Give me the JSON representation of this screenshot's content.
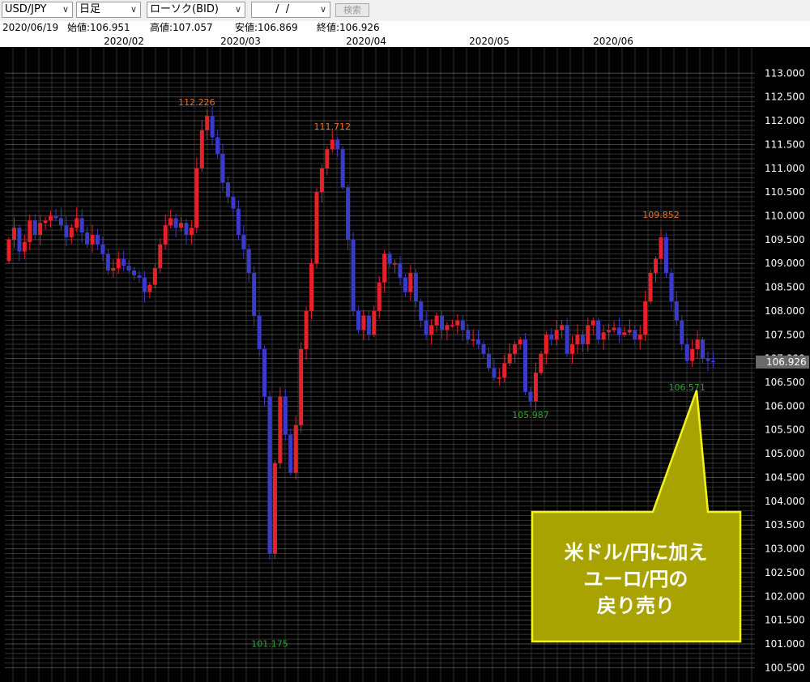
{
  "toolbar": {
    "symbol": "USD/JPY",
    "period": "日足",
    "chart_type": "ローソク(BID)",
    "date_value": " /  / ",
    "search_label": "検索"
  },
  "info": {
    "date": "2020/06/19",
    "open": "始値:106.951",
    "high": "高値:107.057",
    "low": "安値:106.869",
    "close": "終値:106.926"
  },
  "colors": {
    "background": "#000000",
    "up": "#e8202a",
    "down": "#3a3acd",
    "grid": "#303030",
    "high_label": "#f07020",
    "low_label": "#2fa52f",
    "callout_fill": "#a8a300",
    "callout_border": "#f3f31a"
  },
  "icons": {
    "dropdown": "chevron-down-icon"
  },
  "chart_data": {
    "type": "candlestick",
    "x_tick_labels": [
      "2020/02",
      "2020/03",
      "2020/04",
      "2020/05",
      "2020/06"
    ],
    "y_ticks": [
      "113.000",
      "112.500",
      "112.000",
      "111.500",
      "111.000",
      "110.500",
      "110.000",
      "109.500",
      "109.000",
      "108.500",
      "108.000",
      "107.500",
      "107.000",
      "106.500",
      "106.000",
      "105.500",
      "105.000",
      "104.500",
      "104.000",
      "103.500",
      "103.000",
      "102.500",
      "102.000",
      "101.500",
      "101.000",
      "100.500"
    ],
    "ylim": [
      100.2,
      113.55
    ],
    "current_price": "106.926",
    "annotations": [
      {
        "text": "112.226",
        "kind": "high",
        "index": 36,
        "value": 112.226
      },
      {
        "text": "111.712",
        "kind": "high",
        "index": 62,
        "value": 111.712
      },
      {
        "text": "109.852",
        "kind": "high",
        "index": 125,
        "value": 109.852
      },
      {
        "text": "101.175",
        "kind": "low",
        "index": 50,
        "value": 101.175
      },
      {
        "text": "105.987",
        "kind": "low",
        "index": 100,
        "value": 105.987
      },
      {
        "text": "106.571",
        "kind": "low",
        "index": 130,
        "value": 106.571
      }
    ],
    "callout": {
      "lines": [
        "米ドル/円に加え",
        "ユーロ/円の",
        "戻り売り"
      ]
    },
    "closes": [
      109.5,
      109.75,
      109.25,
      109.45,
      109.9,
      109.6,
      109.85,
      109.9,
      110.0,
      109.95,
      109.8,
      109.55,
      109.75,
      109.95,
      109.65,
      109.4,
      109.6,
      109.4,
      109.2,
      108.85,
      108.9,
      109.1,
      108.95,
      108.85,
      108.75,
      108.7,
      108.4,
      108.55,
      108.9,
      109.4,
      109.8,
      109.95,
      109.75,
      109.85,
      109.6,
      109.75,
      111.0,
      111.8,
      112.1,
      111.65,
      111.3,
      110.7,
      110.4,
      110.15,
      109.6,
      109.3,
      108.8,
      107.9,
      107.2,
      106.2,
      102.9,
      104.8,
      106.2,
      105.4,
      104.6,
      105.6,
      107.2,
      108.0,
      109.0,
      110.5,
      111.0,
      111.4,
      111.6,
      111.4,
      110.6,
      109.5,
      108.0,
      107.6,
      107.9,
      107.5,
      108.0,
      108.6,
      109.2,
      109.0,
      109.0,
      108.7,
      108.4,
      108.8,
      108.2,
      107.8,
      107.5,
      107.7,
      107.9,
      107.6,
      107.7,
      107.7,
      107.8,
      107.6,
      107.4,
      107.4,
      107.3,
      107.1,
      106.8,
      106.6,
      106.6,
      106.9,
      107.1,
      107.3,
      107.4,
      106.3,
      106.1,
      106.7,
      107.1,
      107.5,
      107.4,
      107.6,
      107.7,
      107.1,
      107.3,
      107.5,
      107.3,
      107.7,
      107.8,
      107.4,
      107.55,
      107.6,
      107.65,
      107.5,
      107.55,
      107.6,
      107.4,
      107.5,
      108.2,
      108.8,
      109.1,
      109.55,
      108.8,
      108.2,
      107.8,
      107.3,
      106.95,
      107.2,
      107.4,
      107.0,
      106.95,
      106.93
    ]
  }
}
